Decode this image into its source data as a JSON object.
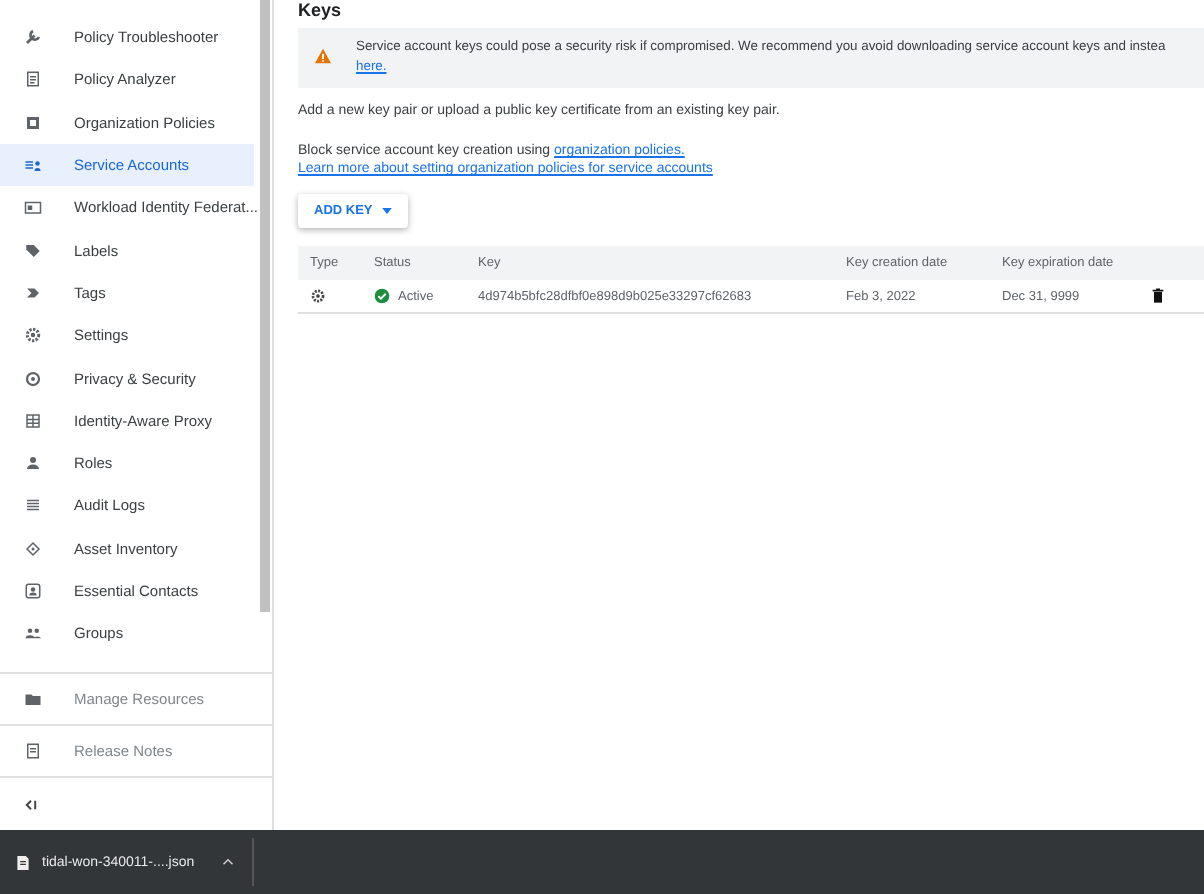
{
  "sidebar": {
    "items": [
      {
        "label": "Policy Troubleshooter",
        "kind": "wrench",
        "selected": false
      },
      {
        "label": "Policy Analyzer",
        "kind": "document",
        "selected": false
      },
      {
        "label": "Organization Policies",
        "kind": "square",
        "selected": false
      },
      {
        "label": "Service Accounts",
        "kind": "account",
        "selected": true
      },
      {
        "label": "Workload Identity Federat...",
        "kind": "card",
        "selected": false
      },
      {
        "label": "Labels",
        "kind": "tag",
        "selected": false
      },
      {
        "label": "Tags",
        "kind": "chevron",
        "selected": false
      },
      {
        "label": "Settings",
        "kind": "gear",
        "selected": false
      },
      {
        "label": "Privacy & Security",
        "kind": "shield",
        "selected": false
      },
      {
        "label": "Identity-Aware Proxy",
        "kind": "grid",
        "selected": false
      },
      {
        "label": "Roles",
        "kind": "person",
        "selected": false
      },
      {
        "label": "Audit Logs",
        "kind": "list",
        "selected": false
      },
      {
        "label": "Asset Inventory",
        "kind": "diamond",
        "selected": false
      },
      {
        "label": "Essential Contacts",
        "kind": "contact",
        "selected": false
      },
      {
        "label": "Groups",
        "kind": "people",
        "selected": false
      }
    ],
    "footer": [
      {
        "label": "Manage Resources",
        "kind": "folder"
      },
      {
        "label": "Release Notes",
        "kind": "document"
      }
    ]
  },
  "page": {
    "title": "Keys",
    "warning": {
      "text": "Service account keys could pose a security risk if compromised. We recommend you avoid downloading service account keys and instea",
      "link": "here."
    },
    "intro": "Add a new key pair or upload a public key certificate from an existing key pair.",
    "block_text": "Block service account key creation using",
    "block_link": "organization policies.",
    "learn_link": "Learn more about setting organization policies for service accounts",
    "add_button": "ADD KEY",
    "table": {
      "columns": [
        "Type",
        "Status",
        "Key",
        "Key creation date",
        "Key expiration date"
      ],
      "rows": [
        {
          "status": "Active",
          "key": "4d974b5bfc28dfbf0e898d9b025e33297cf62683",
          "created": "Feb 3, 2022",
          "expires": "Dec 31, 9999"
        }
      ]
    }
  },
  "download_bar": {
    "file": "tidal-won-340011-....json"
  }
}
